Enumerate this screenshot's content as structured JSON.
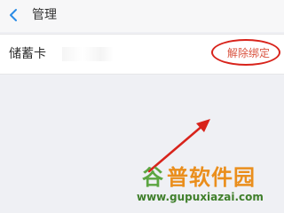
{
  "header": {
    "back_icon": "chevron-left-icon",
    "title": "管理"
  },
  "card": {
    "name": "储蓄卡",
    "unbind_label": "解除绑定"
  },
  "annotation": {
    "highlight_color": "#d8231b"
  },
  "watermark": {
    "mark": "谷",
    "name": "普软件园",
    "url": "www.gupuxiazai.com"
  },
  "colors": {
    "background": "#eff0f4",
    "nav_bar": "#f7f7f8",
    "accent": "#2b8ce6",
    "unbind_text": "#d9533f"
  }
}
